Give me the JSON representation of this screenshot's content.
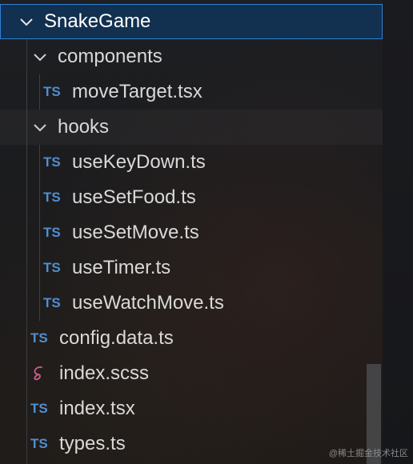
{
  "tree": {
    "root": {
      "label": "SnakeGame"
    },
    "components": {
      "label": "components",
      "items": [
        "moveTarget.tsx"
      ]
    },
    "hooks": {
      "label": "hooks",
      "items": [
        "useKeyDown.ts",
        "useSetFood.ts",
        "useSetMove.ts",
        "useTimer.ts",
        "useWatchMove.ts"
      ]
    },
    "files": [
      "config.data.ts",
      "index.scss",
      "index.tsx",
      "types.ts"
    ]
  },
  "icons": {
    "ts_badge": "TS",
    "ts_color": "#4f8fd0",
    "sass_color": "#d45d8e",
    "folder_chevron": "chevron-down"
  },
  "selection_color": "#12304f",
  "watermark": "@稀土掘金技术社区"
}
